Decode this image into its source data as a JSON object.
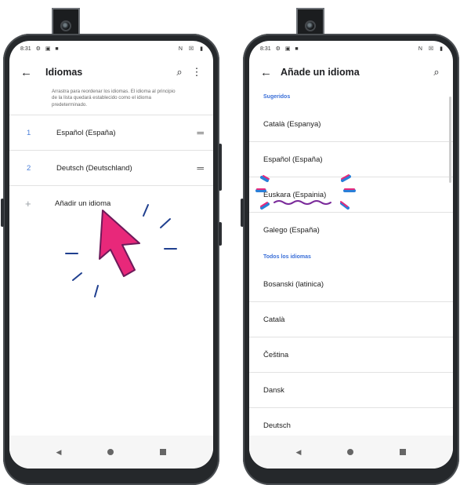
{
  "left_screen": {
    "status": {
      "time": "8:31",
      "icons": "⚙ ▣ ■",
      "right_icons": "N ☒ ▮"
    },
    "appbar": {
      "back_icon": "←",
      "title": "Idiomas",
      "search_icon": "⌕",
      "menu_icon": "⋮"
    },
    "description": "Arrastra para reordenar los idiomas. El idioma al principio de la lista quedará establecido como el idioma predeterminado.",
    "languages": [
      {
        "num": "1",
        "name": "Español (España)",
        "drag_icon": "═"
      },
      {
        "num": "2",
        "name": "Deutsch (Deutschland)",
        "drag_icon": "═"
      }
    ],
    "add": {
      "plus_icon": "+",
      "label": "Añadir un idioma"
    },
    "nav": {
      "back": "◀",
      "home": "",
      "recents": ""
    }
  },
  "right_screen": {
    "status": {
      "time": "8:31",
      "icons": "⚙ ▣ ■",
      "right_icons": "N ☒ ▮"
    },
    "appbar": {
      "back_icon": "←",
      "title": "Añade un idioma",
      "search_icon": "⌕"
    },
    "section_suggested": "Sugeridos",
    "suggested": [
      "Català (Espanya)",
      "Español (España)",
      "Euskara (Espainia)",
      "Galego (España)"
    ],
    "section_all": "Todos los idiomas",
    "all": [
      "Bosanski (latinica)",
      "Català",
      "Čeština",
      "Dansk",
      "Deutsch"
    ],
    "nav": {
      "back": "◀",
      "home": "",
      "recents": ""
    }
  },
  "colors": {
    "accent": "#3a6fd8",
    "pointer": "#e8287a",
    "highlight_blue": "#2a7fd8",
    "highlight_pink": "#e8287a",
    "underline": "#7a2a9a"
  }
}
